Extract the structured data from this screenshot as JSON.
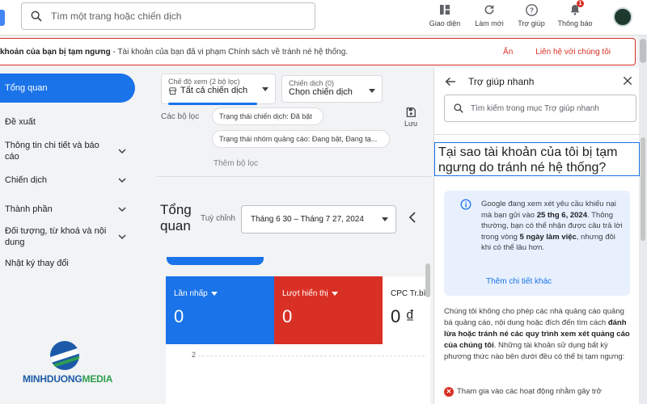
{
  "topbar": {
    "search_placeholder": "Tìm một trang hoặc chiến dịch",
    "appearance": "Giao diện",
    "refresh": "Làm mới",
    "help": "Trợ giúp",
    "notifications": "Thông báo",
    "notification_count": "1"
  },
  "alert": {
    "bold": "khoản của bạn bị tạm ngưng",
    "rest": " - Tài khoản của bạn đã vi phạm Chính sách về tránh né hệ thống.",
    "dismiss": "Ẩn",
    "contact": "Liên hệ với chúng tôi"
  },
  "nav": {
    "overview": "Tổng quan",
    "recommendations": "Đề xuất",
    "insights": "Thông tin chi tiết và báo cáo",
    "campaigns": "Chiến dịch",
    "assets": "Thành phần",
    "audiences": "Đối tượng, từ khoá và nội dung",
    "change_history": "Nhật ký thay đổi"
  },
  "brand": {
    "part1": "MINHDUONG",
    "part2": "MEDIA"
  },
  "main": {
    "view_mode_label": "Chế độ xem (2 bộ lọc)",
    "view_mode_value": "Tất cả chiến dịch",
    "campaign_label": "Chiến dịch (0)",
    "campaign_value": "Chọn chiến dịch",
    "filters_label": "Các bộ lọc",
    "filter1": "Trạng thái chiến dịch: Đã bật",
    "filter2": "Trạng thái nhóm quảng cáo: Đang bật, Đang tạ...",
    "add_filter": "Thêm bộ lọc",
    "save": "Lưu",
    "overview_title": "Tổng quan",
    "custom": "Tuỳ chỉnh",
    "date_range": "Tháng 6 30 – Tháng 7 27, 2024",
    "metrics": [
      {
        "label": "Lần nhấp",
        "value": "0",
        "color": "#1a73e8"
      },
      {
        "label": "Lượt hiển thị",
        "value": "0",
        "color": "#d93025"
      },
      {
        "label": "CPC Tr.bì",
        "value": "0 ₫",
        "color": "#ffffff"
      }
    ],
    "chart_tick": "2"
  },
  "help": {
    "title": "Trợ giúp nhanh",
    "search_placeholder": "Tìm kiếm trong mục Trợ giúp nhanh",
    "question": "Tại sao tài khoản của tôi bị tạm ngưng do tránh né hệ thống?",
    "info_a": "Google đang xem xét yêu cầu khiếu nại mà bạn gửi vào ",
    "info_date": "25 thg 6, 2024",
    "info_b": ". Thông thường, bạn có thể nhận được câu trả lời trong vòng ",
    "info_days": "5 ngày làm việc",
    "info_c": ", nhưng đôi khi có thể lâu hơn.",
    "info_more": "Thêm chi tiết khác",
    "body_a": "Chúng tôi không cho phép các nhà quảng cáo quảng bá quảng cáo, nội dung hoặc đích đến tìm cách ",
    "body_bold": "đánh lừa hoặc tránh né các quy trình xem xét quảng cáo của chúng tôi",
    "body_b": ". Những tài khoản sử dụng bất kỳ phương thức nào bên dưới đều có thể bị tạm ngưng:",
    "bullet1": "Tham gia vào các hoạt động nhằm gây trở"
  }
}
